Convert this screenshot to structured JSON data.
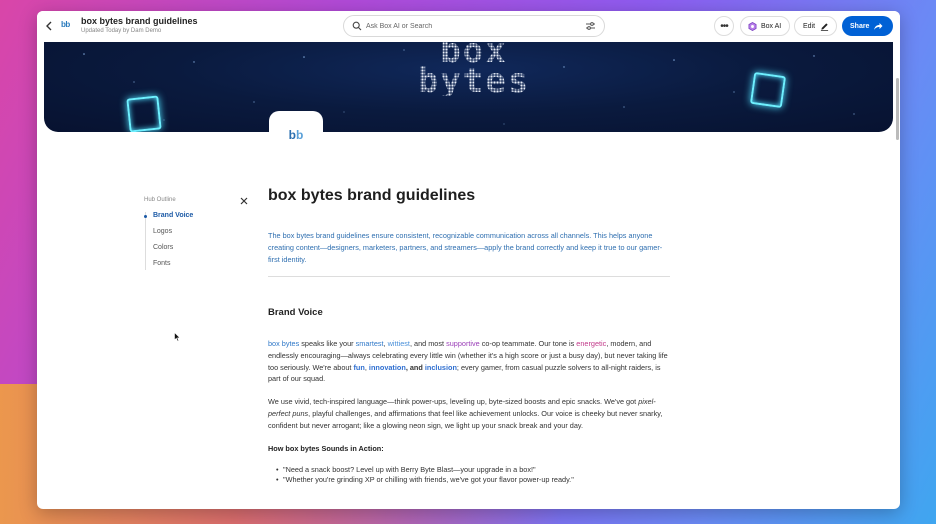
{
  "header": {
    "app_logo": "bb",
    "title": "box bytes brand guidelines",
    "subtitle": "Updated Today by Dam Demo",
    "search_placeholder": "Ask Box AI or Search",
    "more_label": "•••",
    "boxai_label": "Box AI",
    "edit_label": "Edit",
    "share_label": "Share"
  },
  "banner": {
    "title_line1": "box",
    "title_line2": "bytes",
    "hub_logo": [
      "b",
      "b"
    ]
  },
  "outline": {
    "title": "Hub Outline",
    "items": [
      {
        "label": "Brand Voice",
        "active": true
      },
      {
        "label": "Logos",
        "active": false
      },
      {
        "label": "Colors",
        "active": false
      },
      {
        "label": "Fonts",
        "active": false
      }
    ]
  },
  "content": {
    "title": "box bytes brand guidelines",
    "intro": "The box bytes brand guidelines ensure consistent, recognizable communication across all channels. This helps anyone creating content—designers, marketers, partners, and streamers—apply the brand correctly and keep it true to our gamer-first identity.",
    "section_title": "Brand Voice",
    "p1": {
      "brand": "box bytes",
      "t1": " speaks like your ",
      "w1": "smartest",
      "t2": ", ",
      "w2": "wittiest",
      "t3": ", and most ",
      "w3": "supportive",
      "t4": " co-op teammate. Our tone is ",
      "w4": "energetic",
      "t5": ", modern, and endlessly encouraging—always celebrating every little win (whether it's a high score or just a busy day), but never taking life too seriously. We're about ",
      "w5": "fun",
      "t6": ", ",
      "w6": "innovation",
      "t7": ", and ",
      "w7": "inclusion",
      "t8": "; every gamer, from casual puzzle solvers to all-night raiders, is part of our squad."
    },
    "p2": {
      "t1": "We use vivid, tech-inspired language—think power-ups, leveling up, byte-sized boosts and epic snacks. We've got ",
      "em": "pixel-perfect puns",
      "t2": ", playful challenges, and affirmations that feel like achievement unlocks. Our voice is cheeky but never snarky, confident but never arrogant; like a glowing neon sign, we light up your snack break and your day."
    },
    "subheading": "How box bytes Sounds in Action:",
    "bullets": [
      "\"Need a snack boost? Level up with Berry Byte Blast—your upgrade in a box!\"",
      "\"Whether you're grinding XP or chilling with friends, we've got your flavor power-up ready.\""
    ]
  },
  "colors": {
    "share": "#0061d5",
    "link_blue": "#2f78c8",
    "purple": "#9b3fb8",
    "pink": "#c23a8a",
    "banner_bg": "#0a1a3e",
    "neon": "#6ef0ff"
  }
}
